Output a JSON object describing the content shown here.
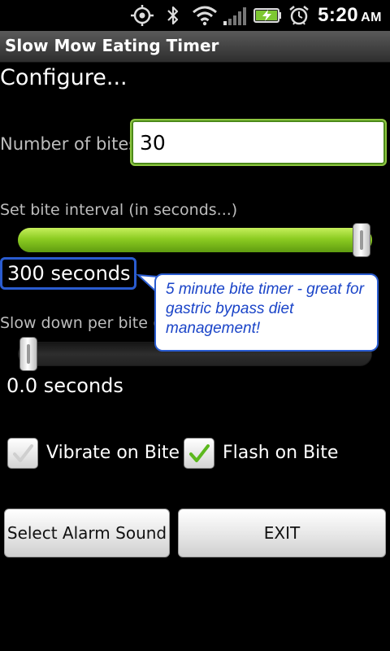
{
  "status_bar": {
    "time": "5:20",
    "ampm": "AM",
    "icons": [
      "gps-icon",
      "bluetooth-icon",
      "wifi-icon",
      "signal-icon",
      "battery-charging-icon",
      "alarm-icon"
    ]
  },
  "app": {
    "title": "Slow Mow Eating Timer"
  },
  "configure": {
    "heading": "Configure..."
  },
  "bites": {
    "label": "Number of bites:",
    "value": "30"
  },
  "interval": {
    "label": "Set bite interval (in seconds...)",
    "fill_fraction": 1.0,
    "value_text": "300 seconds"
  },
  "callout": {
    "text": "5 minute bite timer - great for gastric bypass diet management!"
  },
  "slowdown": {
    "label": "Slow down per bite (",
    "fill_fraction": 0.0,
    "value_text": "0.0 seconds"
  },
  "options": {
    "vibrate_label": "Vibrate on Bite",
    "vibrate_checked": false,
    "flash_label": "Flash on Bite",
    "flash_checked": true
  },
  "buttons": {
    "alarm_label": "Select Alarm Sound",
    "exit_label": "EXIT"
  },
  "colors": {
    "accent_green": "#8dc63f",
    "callout_blue": "#2a5cd0",
    "background": "#000000"
  }
}
